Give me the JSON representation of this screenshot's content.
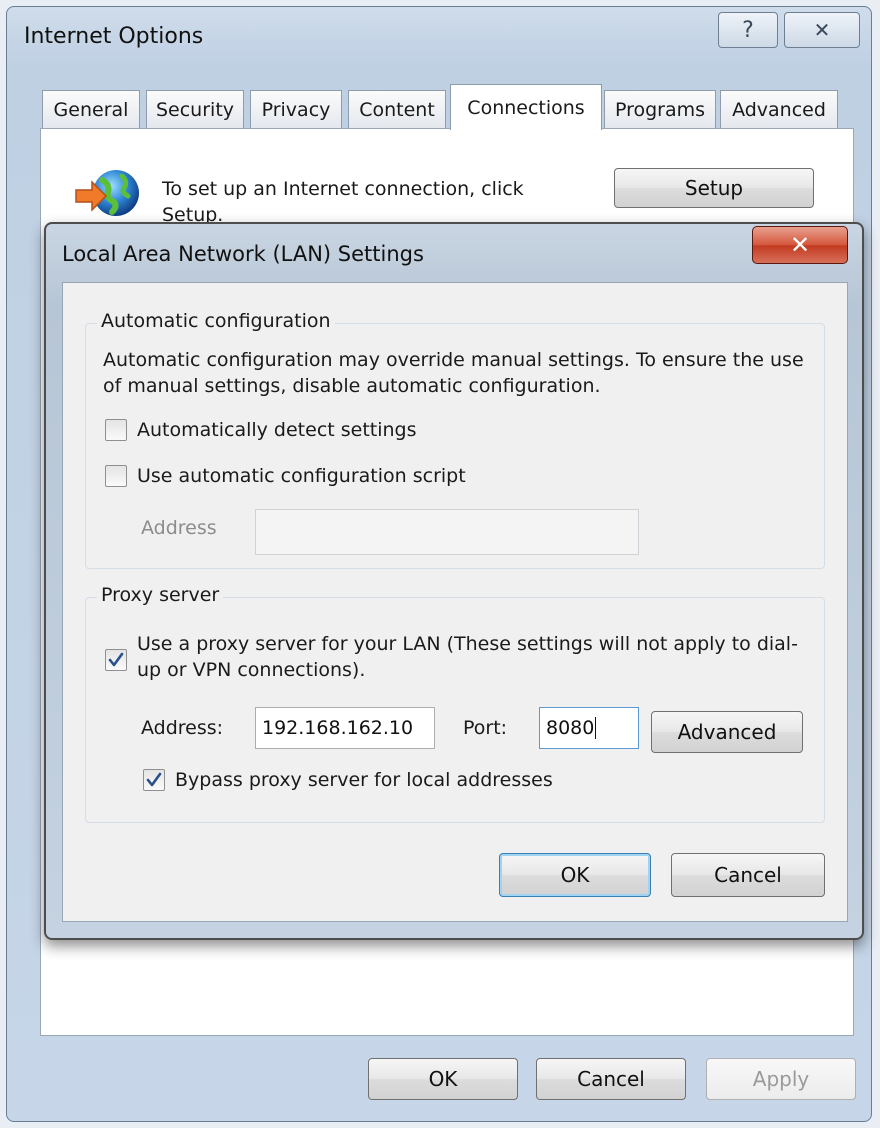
{
  "outer_dialog": {
    "title": "Internet Options",
    "help_glyph": "?",
    "close_glyph": "✕",
    "tabs": [
      {
        "label": "General",
        "active": false
      },
      {
        "label": "Security",
        "active": false
      },
      {
        "label": "Privacy",
        "active": false
      },
      {
        "label": "Content",
        "active": false
      },
      {
        "label": "Connections",
        "active": true
      },
      {
        "label": "Programs",
        "active": false
      },
      {
        "label": "Advanced",
        "active": false
      }
    ],
    "setup_text": "To set up an Internet connection, click Setup.",
    "setup_button": "Setup",
    "ok_button": "OK",
    "cancel_button": "Cancel",
    "apply_button": "Apply",
    "setup_icon": "globe-network-icon"
  },
  "lan_dialog": {
    "title": "Local Area Network (LAN) Settings",
    "close_glyph": "✕",
    "auto_config": {
      "legend": "Automatic configuration",
      "description": "Automatic configuration may override manual settings.  To ensure the use of manual settings, disable automatic configuration.",
      "auto_detect_label": "Automatically detect settings",
      "auto_detect_checked": false,
      "script_label": "Use automatic configuration script",
      "script_checked": false,
      "address_label": "Address",
      "address_value": ""
    },
    "proxy": {
      "legend": "Proxy server",
      "use_proxy_label": "Use a proxy server for your LAN (These settings will not apply to dial-up or VPN connections).",
      "use_proxy_checked": true,
      "address_label": "Address:",
      "address_value": "192.168.162.10",
      "port_label": "Port:",
      "port_value": "8080",
      "advanced_button": "Advanced",
      "bypass_label": "Bypass proxy server for local addresses",
      "bypass_checked": true
    },
    "ok_button": "OK",
    "cancel_button": "Cancel"
  },
  "colors": {
    "accent": "#3c7fb1",
    "close_red": "#c23a20",
    "checkmark": "#2a4f8a"
  }
}
